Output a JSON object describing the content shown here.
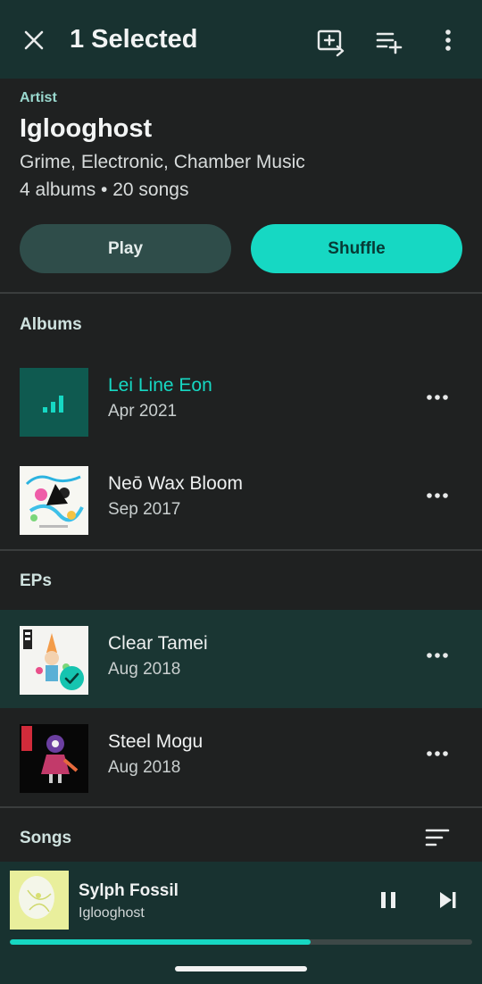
{
  "topbar": {
    "title": "1 Selected",
    "icons": [
      "close-icon",
      "add-to-playlist-icon",
      "queue-add-icon",
      "overflow-menu-icon"
    ]
  },
  "header": {
    "label": "Artist",
    "name": "Iglooghost",
    "genres": "Grime, Electronic, Chamber Music",
    "counts": "4 albums • 20 songs",
    "play_label": "Play",
    "shuffle_label": "Shuffle"
  },
  "albums": {
    "title": "Albums",
    "items": [
      {
        "title": "Lei Line Eon",
        "date": "Apr 2021",
        "playing": true
      },
      {
        "title": "Neō Wax Bloom",
        "date": "Sep 2017"
      }
    ]
  },
  "eps": {
    "title": "EPs",
    "items": [
      {
        "title": "Clear Tamei",
        "date": "Aug 2018",
        "selected": true
      },
      {
        "title": "Steel Mogu",
        "date": "Aug 2018"
      }
    ]
  },
  "songs": {
    "title": "Songs"
  },
  "now_playing": {
    "title": "Sylph Fossil",
    "artist": "Iglooghost",
    "progress": 0.65
  },
  "colors": {
    "accent": "#16d8c3",
    "topbar": "#183230",
    "background": "#1f2121",
    "selected_row": "#1a3633"
  }
}
